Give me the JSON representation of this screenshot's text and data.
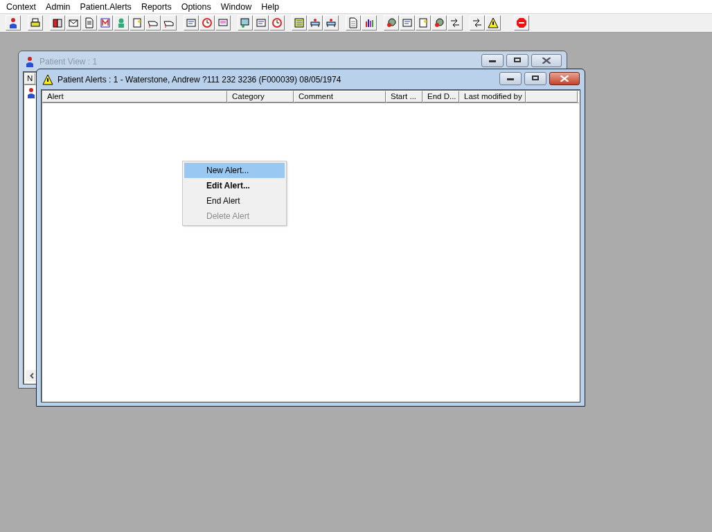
{
  "menu_bar": [
    {
      "label": "Context"
    },
    {
      "label": "Admin"
    },
    {
      "label": "Patient.Alerts"
    },
    {
      "label": "Reports"
    },
    {
      "label": "Options"
    },
    {
      "label": "Window"
    },
    {
      "label": "Help"
    }
  ],
  "windows": [
    {
      "kind": "patient_view",
      "title": "Patient View : 1",
      "active": false,
      "column_1": "N"
    },
    {
      "kind": "alerts",
      "title": "Patient Alerts : 1 - Waterstone, Andrew ?111 232 3236 (F000039) 08/05/1974",
      "active": true,
      "columns": [
        "Alert",
        "Category",
        "Comment",
        "Start ...",
        "End D...",
        "Last modified by"
      ]
    }
  ],
  "context_menu": {
    "items": [
      {
        "label": "New Alert...",
        "selected": true,
        "default": false,
        "disabled": false
      },
      {
        "label": "Edit Alert...",
        "selected": false,
        "default": true,
        "disabled": false
      },
      {
        "label": "End Alert",
        "selected": false,
        "default": false,
        "disabled": false
      },
      {
        "label": "Delete Alert",
        "selected": false,
        "default": false,
        "disabled": true
      }
    ]
  }
}
